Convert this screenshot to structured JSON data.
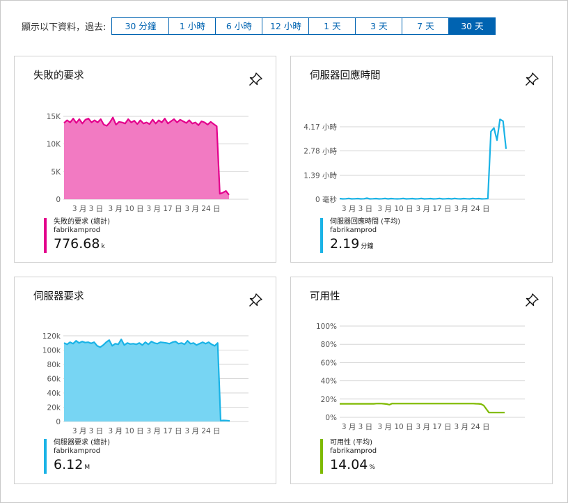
{
  "timebar": {
    "label": "顯示以下資料，過去:",
    "options": [
      "30 分鐘",
      "1 小時",
      "6 小時",
      "12 小時",
      "1 天",
      "3 天",
      "7 天",
      "30 天"
    ],
    "selected_index": 7
  },
  "cards": [
    {
      "title": "失敗的要求",
      "legend": {
        "name": "失敗的要求 (總計)",
        "resource": "fabrikamprod",
        "value": "776.68",
        "unit": "k"
      },
      "color": "#e3008c",
      "fill": "#f27ac2"
    },
    {
      "title": "伺服器回應時間",
      "legend": {
        "name": "伺服器回應時間 (平均)",
        "resource": "fabrikamprod",
        "value": "2.19",
        "unit": "分鐘"
      },
      "color": "#1ab3e6",
      "fill": "none"
    },
    {
      "title": "伺服器要求",
      "legend": {
        "name": "伺服器要求 (總計)",
        "resource": "fabrikamprod",
        "value": "6.12",
        "unit": "M"
      },
      "color": "#1ab3e6",
      "fill": "#77d5f3"
    },
    {
      "title": "可用性",
      "legend": {
        "name": "可用性 (平均)",
        "resource": "fabrikamprod",
        "value": "14.04",
        "unit": "%"
      },
      "color": "#7fba00",
      "fill": "none"
    }
  ],
  "chart_data": [
    {
      "type": "area",
      "title": "失敗的要求",
      "x_ticks": [
        "3 月 3 日",
        "3 月 10 日",
        "3 月 17 日",
        "3 月 24 日"
      ],
      "y_ticks": [
        "15K",
        "10K",
        "5K",
        "0"
      ],
      "ylim": [
        0,
        15000
      ],
      "series": [
        {
          "name": "失敗的要求 (總計)",
          "values": [
            13800,
            14300,
            13900,
            14600,
            13800,
            14500,
            13700,
            14400,
            14600,
            13900,
            14300,
            13900,
            14500,
            13500,
            13300,
            13900,
            14800,
            13500,
            14000,
            13900,
            13700,
            14500,
            13900,
            14200,
            13600,
            14300,
            13700,
            13900,
            13600,
            14400,
            13700,
            14300,
            13900,
            14600,
            13700,
            14100,
            14500,
            13900,
            14400,
            14100,
            13800,
            14300,
            13700,
            13900,
            13400,
            14100,
            13900,
            13500,
            14000,
            13600,
            13200,
            1000,
            1200,
            1500,
            800
          ]
        }
      ]
    },
    {
      "type": "line",
      "title": "伺服器回應時間",
      "x_ticks": [
        "3 月 3 日",
        "3 月 10 日",
        "3 月 17 日",
        "3 月 24 日"
      ],
      "y_ticks": [
        "4.17 小時",
        "2.78 小時",
        "1.39 小時",
        "0 毫秒"
      ],
      "y_units": "hours",
      "ylim": [
        0,
        4.17
      ],
      "series": [
        {
          "name": "伺服器回應時間 (平均)",
          "values": [
            0.04,
            0.02,
            0.03,
            0.05,
            0.02,
            0.03,
            0.04,
            0.02,
            0.03,
            0.06,
            0.02,
            0.03,
            0.04,
            0.02,
            0.03,
            0.05,
            0.02,
            0.04,
            0.03,
            0.02,
            0.03,
            0.05,
            0.02,
            0.03,
            0.04,
            0.02,
            0.03,
            0.05,
            0.02,
            0.03,
            0.04,
            0.02,
            0.03,
            0.05,
            0.02,
            0.03,
            0.04,
            0.02,
            0.05,
            0.03,
            0.02,
            0.04,
            0.03,
            0.02,
            0.05,
            0.03,
            0.04,
            0.02,
            0.03,
            0.04,
            3.9,
            4.1,
            3.4,
            4.6,
            4.5,
            2.9
          ]
        }
      ]
    },
    {
      "type": "area",
      "title": "伺服器要求",
      "x_ticks": [
        "3 月 3 日",
        "3 月 10 日",
        "3 月 17 日",
        "3 月 24 日"
      ],
      "y_ticks": [
        "120k",
        "100k",
        "80k",
        "60k",
        "40k",
        "20k",
        "0"
      ],
      "ylim": [
        0,
        120000
      ],
      "series": [
        {
          "name": "伺服器要求 (總計)",
          "values": [
            110000,
            108000,
            111000,
            109000,
            113000,
            110000,
            112000,
            110500,
            111000,
            109500,
            111000,
            106000,
            104000,
            107000,
            111000,
            114000,
            106000,
            109000,
            108000,
            115000,
            107000,
            110000,
            108500,
            109000,
            108000,
            110000,
            107000,
            111000,
            108000,
            112000,
            110000,
            109000,
            111000,
            110500,
            110000,
            109000,
            111000,
            112000,
            109000,
            110000,
            108000,
            113000,
            109000,
            110000,
            107000,
            109000,
            111000,
            109000,
            111000,
            108000,
            106000,
            110000,
            1200,
            1500,
            1300,
            900
          ]
        }
      ]
    },
    {
      "type": "line",
      "title": "可用性",
      "x_ticks": [
        "3 月 3 日",
        "3 月 10 日",
        "3 月 17 日",
        "3 月 24 日"
      ],
      "y_ticks": [
        "100%",
        "80%",
        "60%",
        "40%",
        "20%",
        "0%"
      ],
      "ylim": [
        0,
        100
      ],
      "series": [
        {
          "name": "可用性 (平均)",
          "values": [
            14.8,
            14.8,
            14.8,
            14.8,
            14.8,
            14.8,
            14.8,
            14.8,
            14.8,
            14.8,
            14.8,
            14.8,
            14.8,
            14.8,
            15.0,
            15.1,
            15.0,
            14.8,
            14.5,
            13.8,
            15.1,
            15.0,
            15.0,
            15.0,
            15.0,
            15.0,
            15.0,
            15.0,
            15.0,
            15.0,
            15.0,
            15.0,
            15.0,
            15.0,
            15.0,
            15.0,
            15.0,
            15.0,
            15.0,
            15.0,
            15.0,
            15.0,
            15.0,
            15.0,
            15.0,
            15.0,
            15.0,
            15.0,
            15.0,
            15.0,
            15.0,
            15.0,
            14.9,
            14.8,
            14.5,
            13.0,
            9.0,
            5.2,
            5.2,
            5.2,
            5.2,
            5.2,
            5.2,
            5.2
          ]
        }
      ]
    }
  ]
}
